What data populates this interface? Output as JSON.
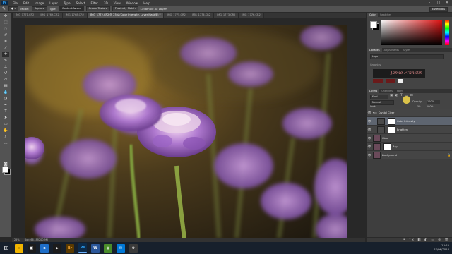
{
  "menubar": {
    "app_logo": "Ps",
    "items": [
      "File",
      "Edit",
      "Image",
      "Layer",
      "Type",
      "Select",
      "Filter",
      "3D",
      "View",
      "Window",
      "Help"
    ]
  },
  "options": {
    "mode_label": "Mode:",
    "mode_value": "Replace",
    "type_label": "Type:",
    "content_aware": "Content-Aware",
    "create_texture": "Create Texture",
    "proximity_match": "Proximity Match",
    "sample_all": "Sample All Layers",
    "workspace": "Essentials"
  },
  "tabs": [
    {
      "label": "IMG_1771.CR2"
    },
    {
      "label": "IMG_1769.CR2"
    },
    {
      "label": "IMG_1768.CR2"
    },
    {
      "label": "IMG_1772.CR2 @ 25% (Color Intensity, Layer Mask/8) *",
      "active": true
    },
    {
      "label": "IMG_1775.CR2"
    },
    {
      "label": "IMG_1774.CR2"
    },
    {
      "label": "IMG_1773.CR2"
    },
    {
      "label": "IMG_1776.CR2"
    }
  ],
  "status": {
    "zoom": "25%",
    "doc_info": "Doc: 66.1M/200.9M"
  },
  "panels": {
    "color_tabs": [
      "Color",
      "Swatches"
    ],
    "library_tabs": [
      "Libraries",
      "Adjustments",
      "Styles"
    ],
    "library_select": "Logo",
    "graphics_heading": "Graphics",
    "watermark_text": "Jamie Franklin",
    "layers_tabs": [
      "Layers",
      "Channels",
      "Paths"
    ],
    "kind_label": "Kind",
    "blend_mode": "Normal",
    "opacity_label": "Opacity:",
    "opacity_value": "100%",
    "lock_label": "Lock:",
    "fill_label": "Fill:",
    "fill_value": "100%",
    "layers": [
      {
        "name": "Crystal Clear",
        "type": "group"
      },
      {
        "name": "Color Intensity",
        "selected": true
      },
      {
        "name": "Brighten"
      },
      {
        "name": "Clear"
      },
      {
        "name": "Ray"
      },
      {
        "name": "Background",
        "italic": true
      }
    ]
  },
  "taskbar": {
    "apps": [
      {
        "name": "windows-start",
        "label": "⊞",
        "color": "#17202c"
      },
      {
        "name": "file-explorer",
        "label": "▭",
        "color": "#f0b400"
      },
      {
        "name": "store",
        "label": "◧",
        "color": "#1c1c1c"
      },
      {
        "name": "edge",
        "label": "e",
        "color": "#1e6ec8"
      },
      {
        "name": "media",
        "label": "▶",
        "color": "#1c1c1c"
      },
      {
        "name": "bridge",
        "label": "Br",
        "color": "#5a3a00"
      },
      {
        "name": "photoshop",
        "label": "Ps",
        "color": "#0c2b4a"
      },
      {
        "name": "word",
        "label": "W",
        "color": "#2b579a"
      },
      {
        "name": "chrome",
        "label": "◉",
        "color": "#4a8c2a"
      },
      {
        "name": "mail",
        "label": "✉",
        "color": "#0078d7"
      },
      {
        "name": "settings",
        "label": "⚙",
        "color": "#3a3a3a"
      }
    ],
    "time": "13:22",
    "date": "27/06/2016"
  }
}
